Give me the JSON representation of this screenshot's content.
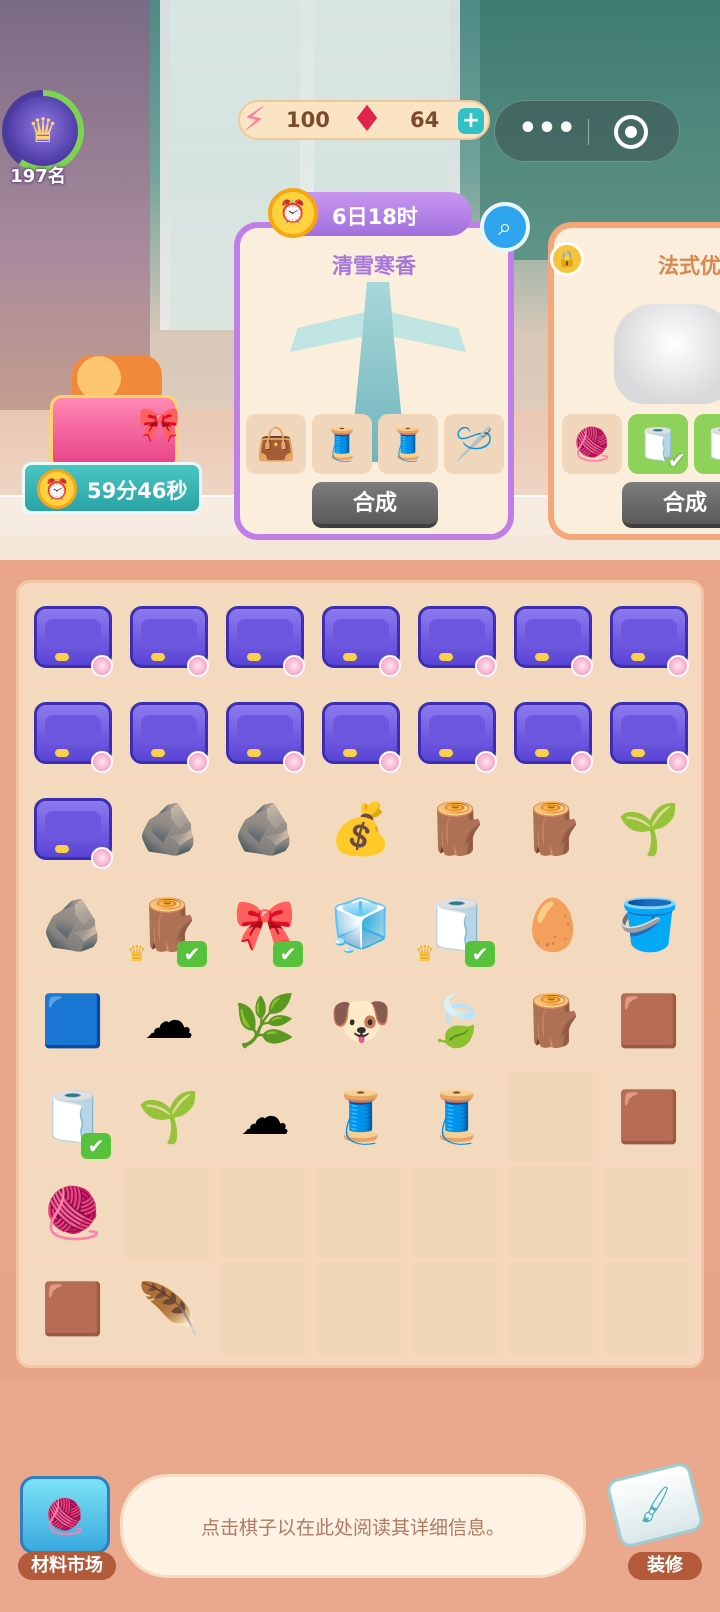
{
  "player": {
    "rank_label": "197名"
  },
  "currency": {
    "energy": "100",
    "gems": "64",
    "add_symbol": "+"
  },
  "capsule": {
    "more_symbol": "•••"
  },
  "gift": {
    "timer": "59分46秒"
  },
  "orders": [
    {
      "timer": "6日18时",
      "title": "清雪寒香",
      "items": [
        {
          "icon": "👜",
          "name": "bag-icon",
          "done": false
        },
        {
          "icon": "🧵",
          "name": "fabric-stack-icon",
          "done": false
        },
        {
          "icon": "🧵",
          "name": "fabric-box-icon",
          "done": false
        },
        {
          "icon": "🪡",
          "name": "sewing-machine-icon",
          "done": false
        }
      ],
      "merge_label": "合成"
    },
    {
      "title": "法式优",
      "items": [
        {
          "icon": "🧶",
          "name": "fabric-crate-icon",
          "done": false
        },
        {
          "icon": "🧻",
          "name": "towel-roll-icon",
          "done": true
        },
        {
          "icon": "🧻",
          "name": "towel-roll-icon",
          "done": true
        }
      ],
      "merge_label": "合成"
    }
  ],
  "board": {
    "cells": [
      "sewbox",
      "sewbox",
      "sewbox",
      "sewbox",
      "sewbox",
      "sewbox",
      "sewbox",
      "sewbox",
      "sewbox",
      "sewbox",
      "sewbox",
      "sewbox",
      "sewbox",
      "sewbox",
      "sewbox",
      "rock",
      "rocks",
      "sack",
      "wood-crate",
      "wood-crate",
      "sprout-box",
      "stone-scoop",
      "crate-ok",
      "mixer-ok",
      "silver-bars",
      "towels-ok",
      "cotton-plate",
      "stone-bucket",
      "cloth",
      "cotton-bowl",
      "sprout-pot",
      "dog-leaf",
      "leaf",
      "logs",
      "bark",
      "towel-roll-ok",
      "seedling",
      "cotton",
      "loom",
      "thread",
      "empty",
      "bark2",
      "yarn",
      "empty",
      "empty",
      "empty",
      "empty",
      "empty",
      "empty",
      "bark",
      "feather",
      "empty",
      "empty",
      "empty",
      "empty",
      "empty"
    ],
    "glyphs": {
      "rock": "🪨",
      "rocks": "🪨",
      "sack": "💰",
      "wood-crate": "🪵",
      "sprout-box": "🌱",
      "stone-scoop": "🪨",
      "crate-ok": "🪵",
      "mixer-ok": "🎀",
      "silver-bars": "🧊",
      "towels-ok": "🧻",
      "cotton-plate": "🥚",
      "stone-bucket": "🪣",
      "cloth": "🟦",
      "cotton-bowl": "☁",
      "sprout-pot": "🌿",
      "dog-leaf": "🐶",
      "leaf": "🍃",
      "logs": "🪵",
      "bark": "🟫",
      "towel-roll-ok": "🧻",
      "seedling": "🌱",
      "cotton": "☁",
      "loom": "🧵",
      "thread": "🧵",
      "bark2": "🟫",
      "yarn": "🧶",
      "feather": "🪶"
    }
  },
  "bottom": {
    "market_label": "材料市场",
    "info_text": "点击棋子以在此处阅读其详细信息。",
    "decorate_label": "装修"
  }
}
